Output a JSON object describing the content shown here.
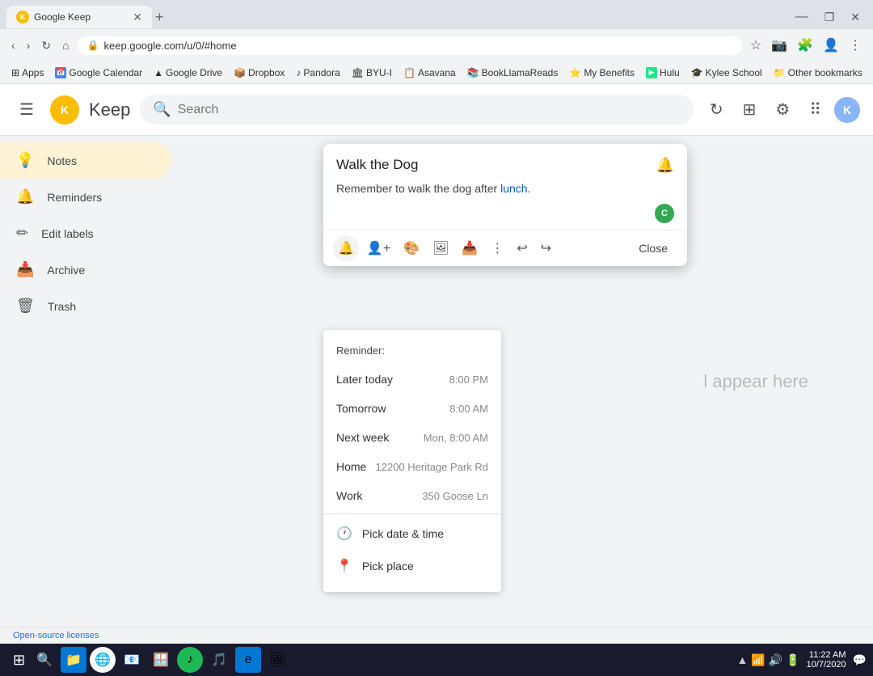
{
  "browser": {
    "tab": {
      "title": "Google Keep",
      "favicon": "K",
      "url": "keep.google.com/u/0/#home"
    },
    "address": "keep.google.com/u/0/#home",
    "bookmarks": [
      {
        "label": "Apps",
        "icon": "⊞"
      },
      {
        "label": "Google Calendar",
        "icon": "📅"
      },
      {
        "label": "Google Drive",
        "icon": "▲"
      },
      {
        "label": "Dropbox",
        "icon": "📦"
      },
      {
        "label": "Pandora",
        "icon": "♪"
      },
      {
        "label": "BYU-I",
        "icon": "🏛"
      },
      {
        "label": "Asavana",
        "icon": "📋"
      },
      {
        "label": "BookLlamaReads",
        "icon": "📚"
      },
      {
        "label": "My Benefits",
        "icon": "⭐"
      },
      {
        "label": "Hulu",
        "icon": "▶"
      },
      {
        "label": "Kylee School",
        "icon": "🎓"
      },
      {
        "label": "Other bookmarks",
        "icon": "»"
      }
    ]
  },
  "header": {
    "logo_letter": "K",
    "app_name": "Keep",
    "search_placeholder": "Search",
    "refresh_icon": "↻",
    "grid_icon": "⊞",
    "settings_icon": "⚙",
    "apps_icon": "⠿",
    "avatar_letter": "K"
  },
  "sidebar": {
    "items": [
      {
        "id": "notes",
        "label": "Notes",
        "icon": "💡",
        "active": true
      },
      {
        "id": "reminders",
        "label": "Reminders",
        "icon": "🔔",
        "active": false
      },
      {
        "id": "edit-labels",
        "label": "Edit labels",
        "icon": "✏",
        "active": false
      },
      {
        "id": "archive",
        "label": "Archive",
        "icon": "📥",
        "active": false
      },
      {
        "id": "trash",
        "label": "Trash",
        "icon": "🗑",
        "active": false
      }
    ]
  },
  "note": {
    "title": "Walk the Dog",
    "body_prefix": "Remember to walk the dog after ",
    "body_highlight": "lunch",
    "body_suffix": ".",
    "pin_icon": "📌",
    "collab_avatar": "C",
    "toolbar": {
      "reminder_icon": "🔔",
      "collaborator_icon": "👤",
      "background_icon": "🎨",
      "image_icon": "🖼",
      "archive_icon": "📥",
      "more_icon": "⋮",
      "undo_icon": "↩",
      "redo_icon": "↪"
    },
    "close_label": "Close"
  },
  "reminder": {
    "label": "Reminder:",
    "options": [
      {
        "label": "Later today",
        "time": "8:00 PM"
      },
      {
        "label": "Tomorrow",
        "time": "8:00 AM"
      },
      {
        "label": "Next week",
        "time": "Mon, 8:00 AM"
      },
      {
        "label": "Home",
        "time": "12200 Heritage Park Rd"
      },
      {
        "label": "Work",
        "time": "350 Goose Ln"
      }
    ],
    "pick_date": "Pick date & time",
    "pick_place": "Pick place",
    "clock_icon": "🕐",
    "place_icon": "📍"
  },
  "empty_state": {
    "text": "l appear here"
  },
  "status_bar": {
    "text": "Open-source licenses"
  },
  "taskbar": {
    "time": "11:22 AM",
    "date": "10/7/2020",
    "start_icon": "⊞",
    "icons": [
      "🔍",
      "🗂",
      "🌐",
      "🎵",
      "⚙",
      "📌",
      "🎮",
      "📊",
      "🌀",
      "🛡"
    ]
  }
}
